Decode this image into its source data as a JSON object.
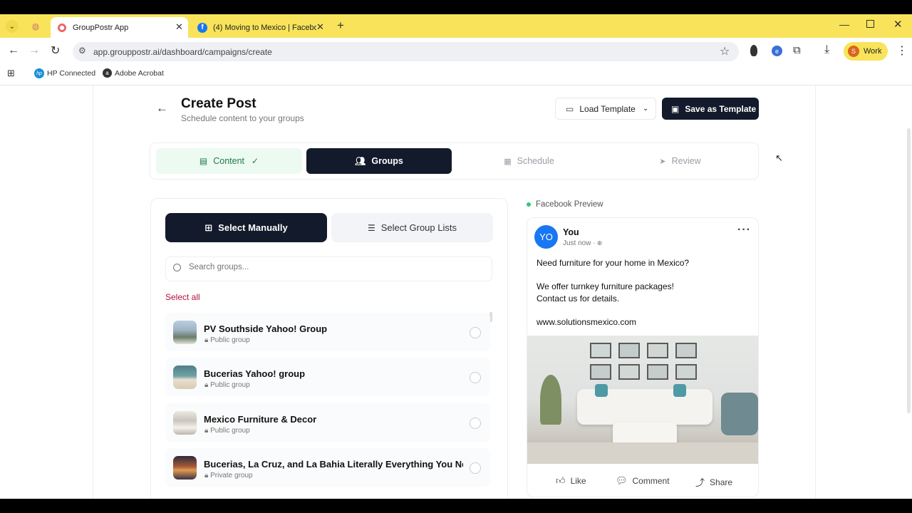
{
  "browser": {
    "tabs": [
      {
        "title": "GroupPostr App",
        "active": true
      },
      {
        "title": "(4) Moving to Mexico | Faceboo",
        "active": false
      }
    ],
    "url": "app.grouppostr.ai/dashboard/campaigns/create",
    "profile_label": "Work",
    "profile_initial": "S",
    "extension_initial": "e",
    "bookmarks": [
      "HP Connected",
      "Adobe Acrobat"
    ]
  },
  "header": {
    "title": "Create Post",
    "subtitle": "Schedule content to your groups",
    "load_template_label": "Load Template",
    "save_template_label": "Save as Template"
  },
  "steps": [
    {
      "label": "Content",
      "state": "done"
    },
    {
      "label": "Groups",
      "state": "active"
    },
    {
      "label": "Schedule",
      "state": "pending"
    },
    {
      "label": "Review",
      "state": "pending"
    }
  ],
  "selector": {
    "manual_label": "Select Manually",
    "lists_label": "Select Group Lists",
    "search_placeholder": "Search groups...",
    "select_all_label": "Select all"
  },
  "groups": [
    {
      "name": "PV Southside Yahoo! Group",
      "type": "Public group"
    },
    {
      "name": "Bucerias Yahoo! group",
      "type": "Public group"
    },
    {
      "name": "Mexico Furniture & Decor",
      "type": "Public group"
    },
    {
      "name": "Bucerias, La Cruz, and La Bahia Literally Everything You Nee...",
      "type": "Private group"
    }
  ],
  "preview": {
    "heading": "Facebook Preview",
    "avatar_initials": "YO",
    "author": "You",
    "time": "Just now",
    "line1": "Need furniture for your home in Mexico?",
    "line2": "We offer turnkey furniture packages!",
    "line3": "Contact us for details.",
    "line4": "www.solutionsmexico.com",
    "like_label": "Like",
    "comment_label": "Comment",
    "share_label": "Share"
  },
  "colors": {
    "tabstrip": "#f8e35a",
    "dark": "#131a2b",
    "accent_red": "#b3123c",
    "success_green": "#34c77b",
    "facebook_blue": "#1877f2"
  }
}
